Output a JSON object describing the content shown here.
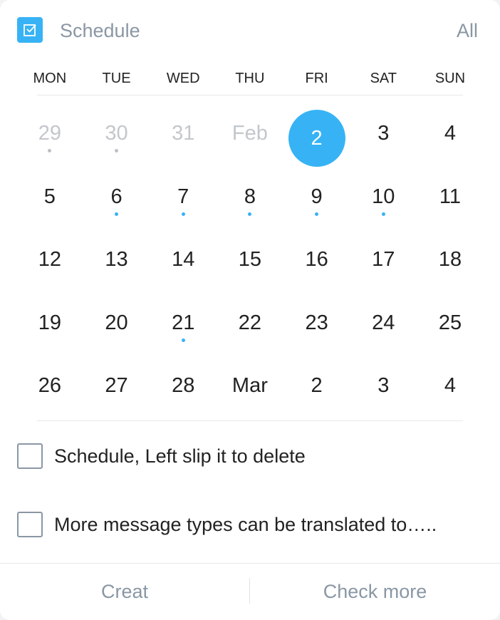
{
  "header": {
    "title": "Schedule",
    "all_label": "All",
    "icon": "calendar-check-icon",
    "accent": "#37b3f5"
  },
  "weekdays": [
    "MON",
    "TUE",
    "WED",
    "THU",
    "FRI",
    "SAT",
    "SUN"
  ],
  "calendar": {
    "selected_day": "2",
    "rows": [
      [
        {
          "label": "29",
          "muted": true,
          "dot": "grey"
        },
        {
          "label": "30",
          "muted": true,
          "dot": "grey"
        },
        {
          "label": "31",
          "muted": true,
          "dot": null
        },
        {
          "label": "Feb",
          "muted": true,
          "dot": null
        },
        {
          "label": "2",
          "muted": false,
          "dot": null,
          "selected": true
        },
        {
          "label": "3",
          "muted": false,
          "dot": null
        },
        {
          "label": "4",
          "muted": false,
          "dot": null
        }
      ],
      [
        {
          "label": "5",
          "muted": false,
          "dot": null
        },
        {
          "label": "6",
          "muted": false,
          "dot": "blue"
        },
        {
          "label": "7",
          "muted": false,
          "dot": "blue"
        },
        {
          "label": "8",
          "muted": false,
          "dot": "blue"
        },
        {
          "label": "9",
          "muted": false,
          "dot": "blue"
        },
        {
          "label": "10",
          "muted": false,
          "dot": "blue"
        },
        {
          "label": "11",
          "muted": false,
          "dot": null
        }
      ],
      [
        {
          "label": "12",
          "muted": false,
          "dot": null
        },
        {
          "label": "13",
          "muted": false,
          "dot": null
        },
        {
          "label": "14",
          "muted": false,
          "dot": null
        },
        {
          "label": "15",
          "muted": false,
          "dot": null
        },
        {
          "label": "16",
          "muted": false,
          "dot": null
        },
        {
          "label": "17",
          "muted": false,
          "dot": null
        },
        {
          "label": "18",
          "muted": false,
          "dot": null
        }
      ],
      [
        {
          "label": "19",
          "muted": false,
          "dot": null
        },
        {
          "label": "20",
          "muted": false,
          "dot": null
        },
        {
          "label": "21",
          "muted": false,
          "dot": "blue"
        },
        {
          "label": "22",
          "muted": false,
          "dot": null
        },
        {
          "label": "23",
          "muted": false,
          "dot": null
        },
        {
          "label": "24",
          "muted": false,
          "dot": null
        },
        {
          "label": "25",
          "muted": false,
          "dot": null
        }
      ],
      [
        {
          "label": "26",
          "muted": false,
          "dot": null
        },
        {
          "label": "27",
          "muted": false,
          "dot": null
        },
        {
          "label": "28",
          "muted": false,
          "dot": null
        },
        {
          "label": "Mar",
          "muted": false,
          "dot": null
        },
        {
          "label": "2",
          "muted": false,
          "dot": null
        },
        {
          "label": "3",
          "muted": false,
          "dot": null
        },
        {
          "label": "4",
          "muted": false,
          "dot": null
        }
      ]
    ]
  },
  "todos": [
    {
      "text": "Schedule, Left slip it to delete",
      "checked": false
    },
    {
      "text": "More message types can be translated to…..",
      "checked": false
    }
  ],
  "footer": {
    "create_label": "Creat",
    "more_label": "Check more"
  }
}
